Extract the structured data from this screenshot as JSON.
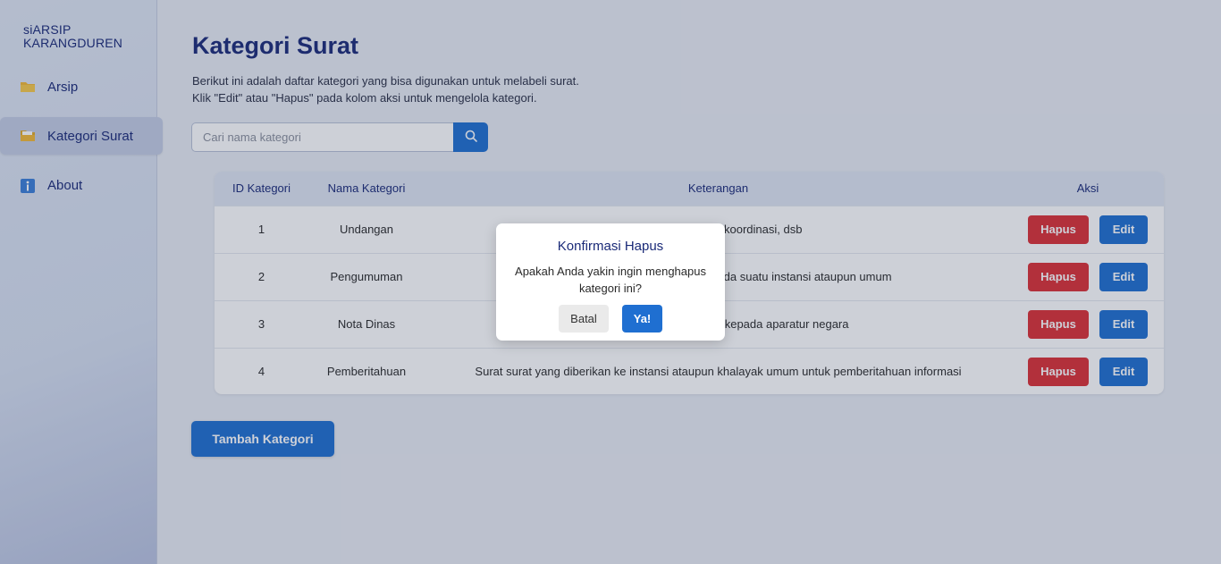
{
  "sidebar": {
    "brand_line1": "siARSIP",
    "brand_line2": "KARANGDUREN",
    "items": [
      {
        "label": "Arsip",
        "icon": "folder-icon"
      },
      {
        "label": "Kategori Surat",
        "icon": "folder-open-icon",
        "active": true
      },
      {
        "label": "About",
        "icon": "info-icon"
      }
    ]
  },
  "page": {
    "title": "Kategori Surat",
    "desc_line1": "Berikut ini adalah daftar kategori yang bisa digunakan untuk melabeli surat.",
    "desc_line2": "Klik \"Edit\" atau \"Hapus\" pada kolom aksi untuk mengelola kategori."
  },
  "search": {
    "placeholder": "Cari nama kategori",
    "value": ""
  },
  "table": {
    "headers": [
      "ID Kategori",
      "Nama Kategori",
      "Keterangan",
      "Aksi"
    ],
    "rows": [
      {
        "id": "1",
        "name": "Undangan",
        "desc": "Undangan rapat, koordinasi, dsb"
      },
      {
        "id": "2",
        "name": "Pengumuman",
        "desc": "Pengumuman yang ditujukan kepada suatu instansi ataupun umum"
      },
      {
        "id": "3",
        "name": "Nota Dinas",
        "desc": "Nota dinas yang ditujukan kepada aparatur negara"
      },
      {
        "id": "4",
        "name": "Pemberitahuan",
        "desc": "Surat surat yang diberikan ke instansi ataupun khalayak umum untuk pemberitahuan informasi"
      }
    ],
    "delete_label": "Hapus",
    "edit_label": "Edit"
  },
  "add_button": "Tambah Kategori",
  "modal": {
    "title": "Konfirmasi Hapus",
    "message": "Apakah Anda yakin ingin menghapus kategori ini?",
    "cancel_label": "Batal",
    "confirm_label": "Ya!"
  },
  "colors": {
    "accent": "#1f6fd1",
    "danger": "#dc2f35",
    "heading": "#1a2a78"
  }
}
